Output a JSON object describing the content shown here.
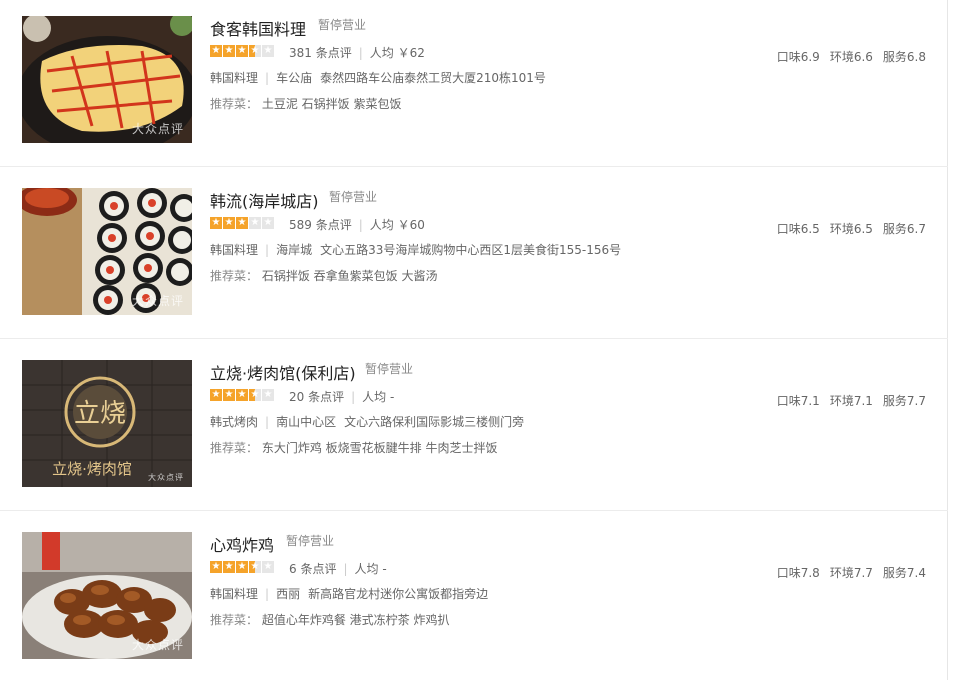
{
  "watermark": "大众点评",
  "labels": {
    "reviews_suffix": "条点评",
    "avg_prefix": "人均",
    "recommend_prefix": "推荐菜："
  },
  "colors": {
    "star_on": "#f5a32a",
    "star_off": "#e6e6e6"
  },
  "restaurants": [
    {
      "name": "食客韩国料理",
      "status": "暂停营业",
      "stars": 3.5,
      "reviews": "381",
      "avg_price": "￥62",
      "cuisine": "韩国料理",
      "area": "车公庙",
      "address": "泰然四路车公庙泰然工贸大厦210栋101号",
      "dishes": "土豆泥 石锅拌饭 紫菜包饭",
      "scores": {
        "taste": "口味6.9",
        "env": "环境6.6",
        "service": "服务6.8"
      }
    },
    {
      "name": "韩流(海岸城店)",
      "status": "暂停营业",
      "stars": 3,
      "reviews": "589",
      "avg_price": "￥60",
      "cuisine": "韩国料理",
      "area": "海岸城",
      "address": "文心五路33号海岸城购物中心西区1层美食街155-156号",
      "dishes": "石锅拌饭 吞拿鱼紫菜包饭 大酱汤",
      "scores": {
        "taste": "口味6.5",
        "env": "环境6.5",
        "service": "服务6.7"
      }
    },
    {
      "name": "立烧·烤肉馆(保利店)",
      "status": "暂停营业",
      "stars": 3.5,
      "reviews": "20",
      "avg_price": "-",
      "cuisine": "韩式烤肉",
      "area": "南山中心区",
      "address": "文心六路保利国际影城三楼侧门旁",
      "dishes": "东大门炸鸡 板烧雪花板腱牛排 牛肉芝士拌饭",
      "scores": {
        "taste": "口味7.1",
        "env": "环境7.1",
        "service": "服务7.7"
      }
    },
    {
      "name": "心鸡炸鸡",
      "status": "暂停营业",
      "stars": 3.5,
      "reviews": "6",
      "avg_price": "-",
      "cuisine": "韩国料理",
      "area": "西丽",
      "address": "新高路官龙村迷你公寓饭都指旁边",
      "dishes": "超值心年炸鸡餐 港式冻柠茶 炸鸡扒",
      "scores": {
        "taste": "口味7.8",
        "env": "环境7.7",
        "service": "服务7.4"
      }
    }
  ]
}
